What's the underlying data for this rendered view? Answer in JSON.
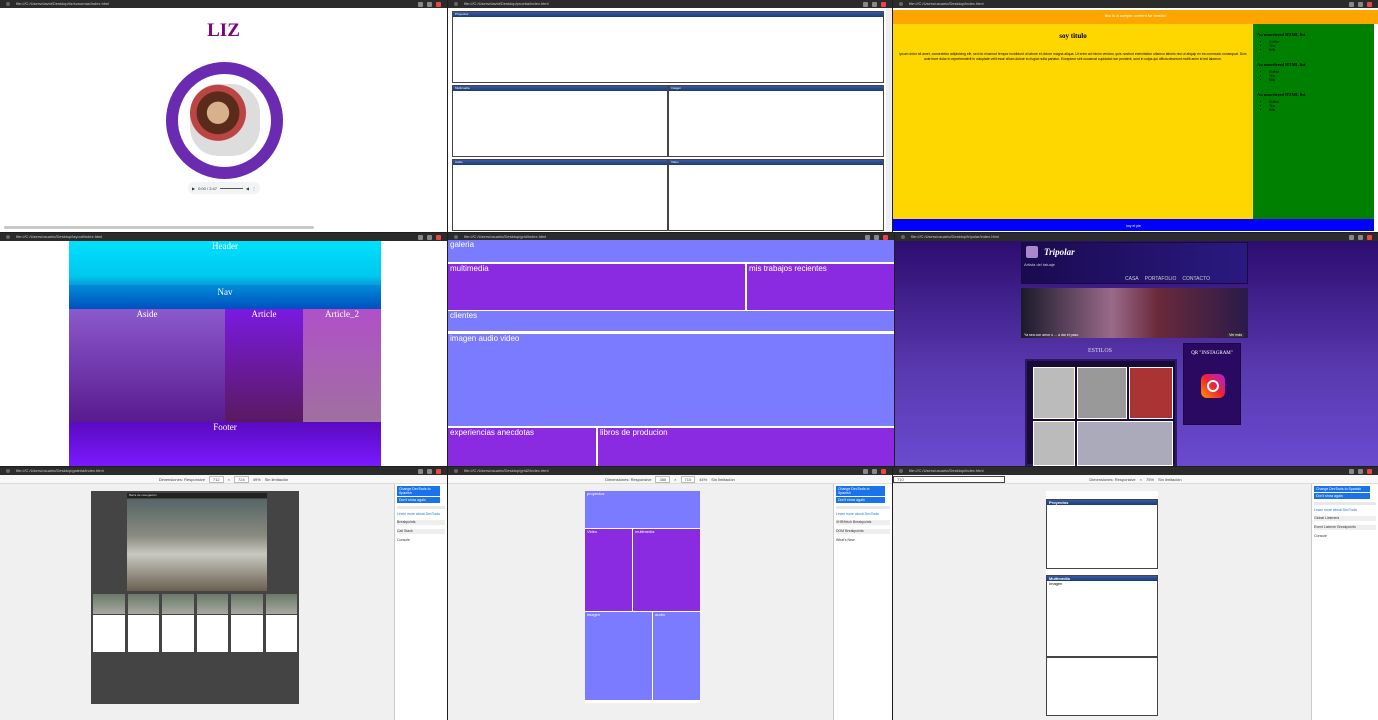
{
  "tiles": {
    "t1": {
      "url": "file:///C:/Users/david/Desktop/liz/sonomas/index.html",
      "title": "LIZ",
      "audio_time": "0:00 / 2:47"
    },
    "t2": {
      "url": "file:///C:/Users/david/Desktop/prueba/index.html",
      "panels": [
        "Proyectos",
        "Multimedia",
        "Imagen",
        "Audio",
        "Video"
      ]
    },
    "t3": {
      "url": "file:///C:/Users/usuario/Desktop/index.html",
      "top_text": "this is a sample content for header",
      "main_title": "soy titulo",
      "main_text": "ipsum dolor sit amet, consectetur adipisicing elit, sed do eiusmod tempor incididunt ut labore et dolore magna aliqua. Ut enim ad minim veniam, quis nostrud exercitation ullamco laboris nisi ut aliquip ex ea commodo consequat. Duis aute irure dolor in reprehenderit in voluptate velit esse cillum dolore eu fugiat nulla pariatur. Excepteur sint occaecat cupidatat non proident, sunt in culpa qui officia deserunt mollit anim id est laborum.",
      "side_heading": "An unordered HTML list",
      "side_items": [
        "Coffee",
        "Tea",
        "Milk"
      ],
      "footer": "soy el pie"
    },
    "t4": {
      "url": "file:///C:/Users/usuario/Desktop/layout/index.html",
      "header": "Header",
      "nav": "Nav",
      "aside": "Aside",
      "article": "Article",
      "article2": "Article_2",
      "footer": "Footer"
    },
    "t5": {
      "url": "file:///C:/Users/usuario/Desktop/grid/index.html",
      "cells": {
        "galeria": "galeria",
        "multimedia": "multimedia",
        "trabajos": "mis trabajos recientes",
        "clientes": "clientes",
        "imagen": "imagen audio video",
        "experiencias": "experiencias anecdotas",
        "libros": "libros de producion"
      }
    },
    "t6": {
      "url": "file:///C:/Users/usuario/Desktop/tripolar/index.html",
      "brand": "Tripolar",
      "sub": "Artista del tatuaje",
      "menu": [
        "CASA",
        "PORTAFOLIO",
        "CONTACTO"
      ],
      "banner_caption": "Ya sea con amor o ... a dar el paso.",
      "banner_button": "Ver más",
      "estilos": "ESTILOS",
      "qr": "QR \"INSTAGRAM\""
    },
    "t7": {
      "url": "file:///C:/Users/usuario/Desktop/galeria/index.html",
      "device": "Dimensiones: Responsive",
      "w": "712",
      "h": "724",
      "zoom": "49%",
      "throttle": "Sin limitación",
      "navbar": "Barra de navegación"
    },
    "t8": {
      "url": "file:///C:/Users/usuario/Desktop/grid2/index.html",
      "device": "Dimensiones: Responsive",
      "w": "350",
      "h": "710",
      "zoom": "44%",
      "throttle": "Sin limitación",
      "cells": {
        "proyectos": "proyectos",
        "video": "Video",
        "multimedia": "multimedia",
        "imagen": "imagen",
        "audio": "audio"
      }
    },
    "t9": {
      "url": "file:///C:/Users/usuario/Desktop/index.html",
      "device": "Dimensiones: Responsive",
      "w": "303",
      "h": "710",
      "zoom": "75%",
      "throttle": "Sin limitación",
      "boxes": [
        "Proyectos",
        "Multimedia",
        "Imagen"
      ]
    }
  },
  "devtools": {
    "banner1": "Change DevTools to Spanish",
    "banner2": "Don't show again",
    "link": "Learn more about DevTools",
    "sections": [
      "Breakpoints",
      "Call Stack",
      "XHR/fetch Breakpoints",
      "DOM Breakpoints",
      "Global Listeners",
      "Event Listener Breakpoints"
    ],
    "console_tabs": [
      "Console",
      "What's New"
    ]
  }
}
